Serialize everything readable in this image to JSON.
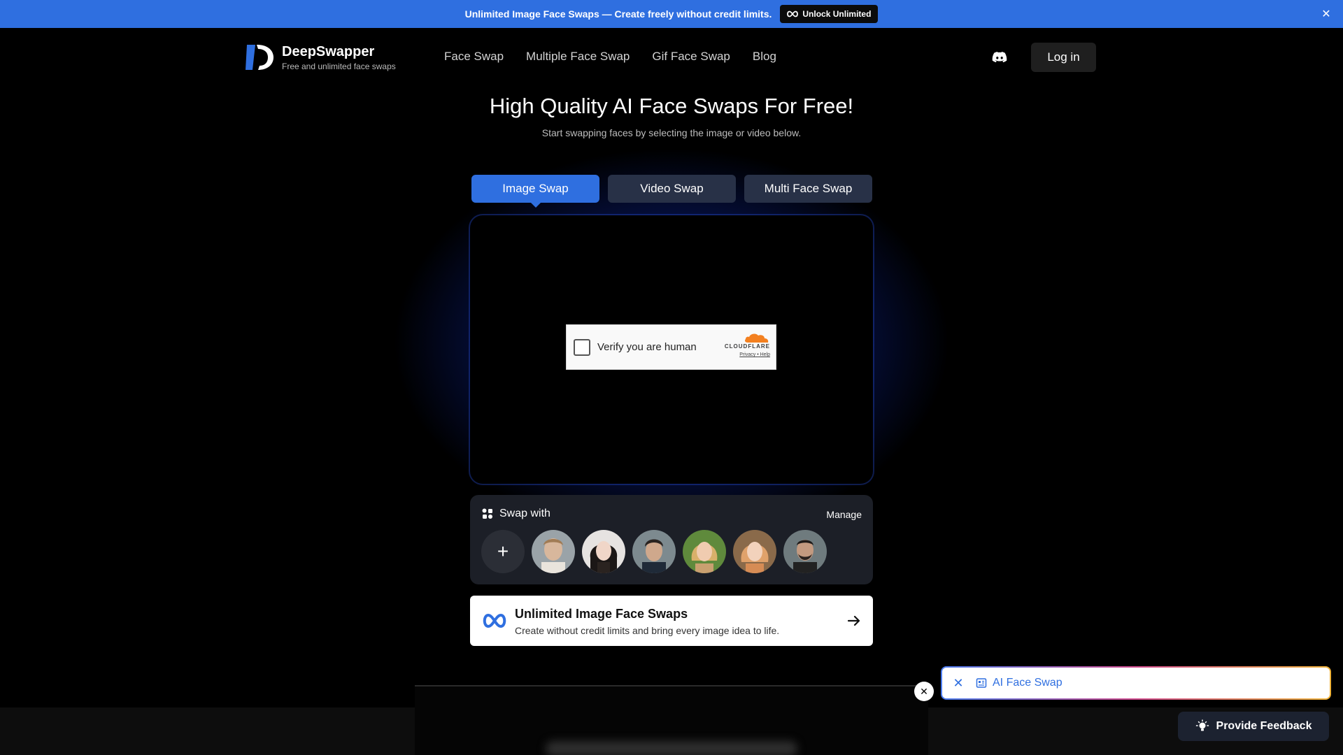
{
  "promo": {
    "text": "Unlimited Image Face Swaps — Create freely without credit limits.",
    "button": "Unlock Unlimited",
    "close_icon": "close-icon"
  },
  "nav": {
    "brand": "DeepSwapper",
    "tagline": "Free and unlimited face swaps",
    "links": [
      "Face Swap",
      "Multiple Face Swap",
      "Gif Face Swap",
      "Blog"
    ],
    "login": "Log in"
  },
  "hero": {
    "title": "High Quality AI Face Swaps For Free!",
    "subtitle": "Start swapping faces by selecting the image or video below."
  },
  "tabs": [
    {
      "label": "Image Swap",
      "active": true
    },
    {
      "label": "Video Swap",
      "active": false
    },
    {
      "label": "Multi Face Swap",
      "active": false
    }
  ],
  "captcha": {
    "label": "Verify you are human",
    "provider": "CLOUDFLARE",
    "privacy": "Privacy",
    "help": "Help"
  },
  "swap": {
    "title": "Swap with",
    "manage": "Manage",
    "add": "+"
  },
  "unlimited": {
    "title": "Unlimited Image Face Swaps",
    "subtitle": "Create without credit limits and bring every image idea to life."
  },
  "widget": {
    "label": "AI Face Swap"
  },
  "feedback": {
    "label": "Provide Feedback"
  },
  "colors": {
    "accent": "#2f6fe0",
    "tab_inactive": "#283147",
    "cloudflare": "#f38020"
  }
}
